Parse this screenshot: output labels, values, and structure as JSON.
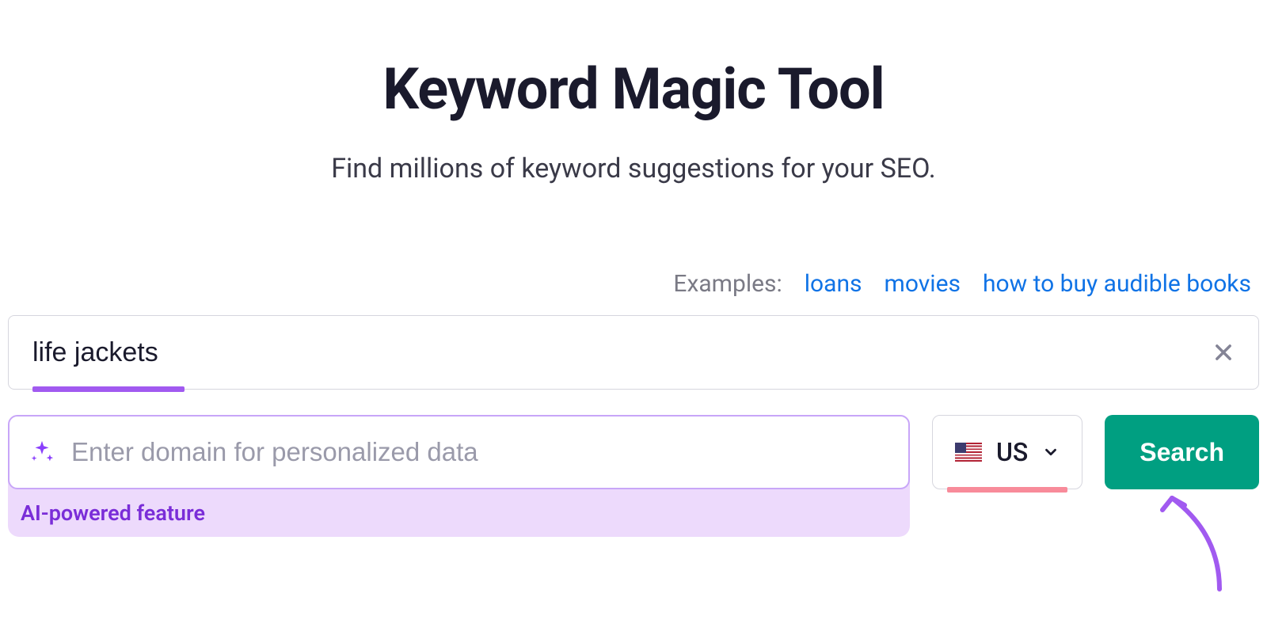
{
  "header": {
    "title": "Keyword Magic Tool",
    "subtitle": "Find millions of keyword suggestions for your SEO."
  },
  "examples": {
    "label": "Examples:",
    "items": [
      "loans",
      "movies",
      "how to buy audible books"
    ]
  },
  "keyword_input": {
    "value": "life jackets"
  },
  "domain_input": {
    "placeholder": "Enter domain for personalized data",
    "ai_label": "AI-powered feature"
  },
  "country": {
    "code": "US"
  },
  "search_button": {
    "label": "Search"
  }
}
